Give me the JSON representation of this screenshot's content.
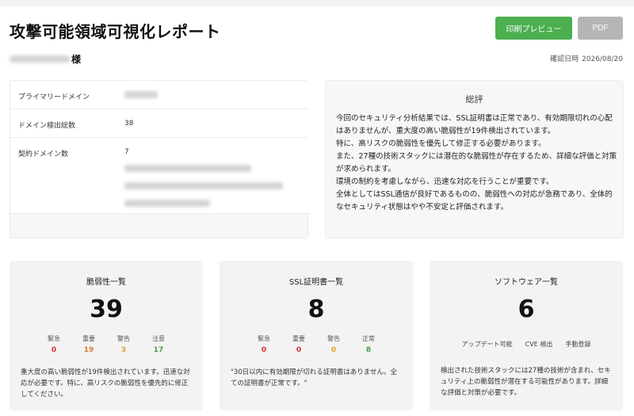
{
  "header": {
    "title": "攻撃可能領域可視化レポート",
    "print_preview_label": "印刷プレビュー",
    "pdf_label": "PDF",
    "customer_suffix": "様",
    "confirm_label": "確認日時",
    "confirm_date": "2026/08/20"
  },
  "domains": {
    "primary_label": "プライマリードメイン",
    "count_label": "ドメイン検出総数",
    "count_value": "38",
    "contract_label": "契約ドメイン数",
    "contract_value": "7"
  },
  "summary": {
    "title": "総評",
    "lines": [
      "今回のセキュリティ分析結果では、SSL証明書は正常であり、有効期限切れの心配はありませんが、重大度の高い脆弱性が19件検出されています。",
      "特に、高リスクの脆弱性を優先して修正する必要があります。",
      "また、27種の技術スタックには潜在的な脆弱性が存在するため、詳細な評価と対策が求められます。",
      "環境の制約を考慮しながら、迅速な対応を行うことが重要です。",
      "全体としてはSSL通信が良好であるものの、脆弱性への対応が急務であり、全体的なセキュリティ状態はやや不安定と評価されます。"
    ]
  },
  "vulnerabilities": {
    "title": "脆弱性一覧",
    "total": "39",
    "levels": [
      {
        "label": "緊急",
        "value": "0"
      },
      {
        "label": "重要",
        "value": "19"
      },
      {
        "label": "警告",
        "value": "3"
      },
      {
        "label": "注意",
        "value": "17"
      }
    ],
    "note": "重大度の高い脆弱性が19件検出されています。迅速な対応が必要です。特に、高リスクの脆弱性を優先的に修正してください。"
  },
  "ssl": {
    "title": "SSL証明書一覧",
    "total": "8",
    "levels": [
      {
        "label": "緊急",
        "value": "0"
      },
      {
        "label": "重要",
        "value": "0"
      },
      {
        "label": "警告",
        "value": "0"
      },
      {
        "label": "正常",
        "value": "8"
      }
    ],
    "note": "\"30日以内に有効期限が切れる証明書はありません。全ての証明書が正常です。\""
  },
  "software": {
    "title": "ソフトウェア一覧",
    "total": "6",
    "labels": [
      "アップデート可能",
      "CVE 検出",
      "手動登録"
    ],
    "note": "検出された技術スタックには27種の技術が含まれ、セキュリティ上の脆弱性が潜在する可能性があります。詳細な評価と対策が必要です。"
  },
  "colors": {
    "primary_button": "#4caf50",
    "disabled_button": "#b5b5b5",
    "critical": "#d32f2f",
    "important": "#e07b39",
    "warning": "#e0a030",
    "ok": "#43a047"
  }
}
